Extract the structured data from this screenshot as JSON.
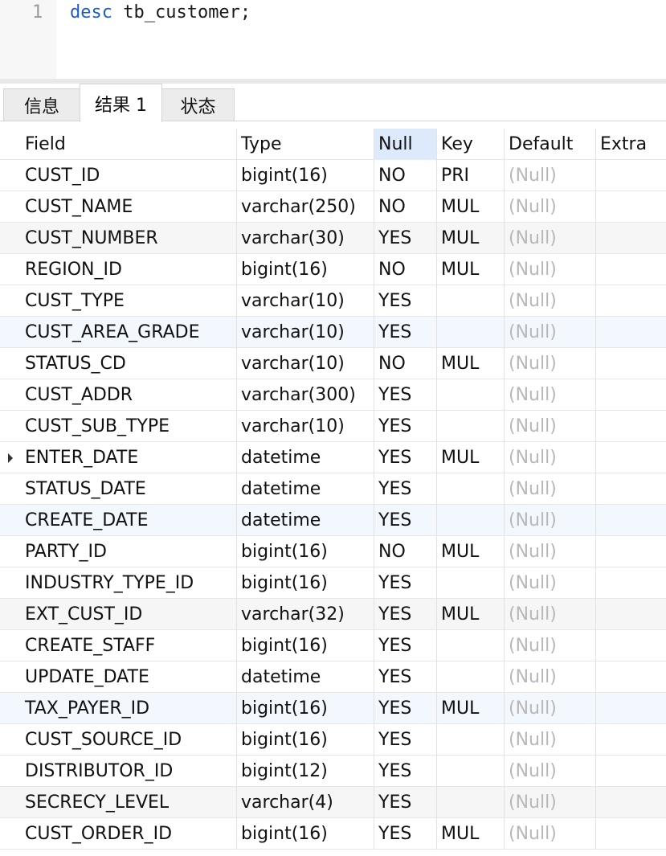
{
  "editor": {
    "line_number": "1",
    "keyword": "desc",
    "rest": " tb_customer;"
  },
  "tabs": [
    {
      "label": "信息",
      "active": false
    },
    {
      "label": "结果 1",
      "active": true
    },
    {
      "label": "状态",
      "active": false
    }
  ],
  "grid": {
    "columns": [
      "Field",
      "Type",
      "Null",
      "Key",
      "Default",
      "Extra"
    ],
    "null_label": "(Null)",
    "current_row_index": 9,
    "rows": [
      [
        "CUST_ID",
        "bigint(16)",
        "NO",
        "PRI",
        "(Null)",
        ""
      ],
      [
        "CUST_NAME",
        "varchar(250)",
        "NO",
        "MUL",
        "(Null)",
        ""
      ],
      [
        "CUST_NUMBER",
        "varchar(30)",
        "YES",
        "MUL",
        "(Null)",
        ""
      ],
      [
        "REGION_ID",
        "bigint(16)",
        "NO",
        "MUL",
        "(Null)",
        ""
      ],
      [
        "CUST_TYPE",
        "varchar(10)",
        "YES",
        "",
        "(Null)",
        ""
      ],
      [
        "CUST_AREA_GRADE",
        "varchar(10)",
        "YES",
        "",
        "(Null)",
        ""
      ],
      [
        "STATUS_CD",
        "varchar(10)",
        "NO",
        "MUL",
        "(Null)",
        ""
      ],
      [
        "CUST_ADDR",
        "varchar(300)",
        "YES",
        "",
        "(Null)",
        ""
      ],
      [
        "CUST_SUB_TYPE",
        "varchar(10)",
        "YES",
        "",
        "(Null)",
        ""
      ],
      [
        "ENTER_DATE",
        "datetime",
        "YES",
        "MUL",
        "(Null)",
        ""
      ],
      [
        "STATUS_DATE",
        "datetime",
        "YES",
        "",
        "(Null)",
        ""
      ],
      [
        "CREATE_DATE",
        "datetime",
        "YES",
        "",
        "(Null)",
        ""
      ],
      [
        "PARTY_ID",
        "bigint(16)",
        "NO",
        "MUL",
        "(Null)",
        ""
      ],
      [
        "INDUSTRY_TYPE_ID",
        "bigint(16)",
        "YES",
        "",
        "(Null)",
        ""
      ],
      [
        "EXT_CUST_ID",
        "varchar(32)",
        "YES",
        "MUL",
        "(Null)",
        ""
      ],
      [
        "CREATE_STAFF",
        "bigint(16)",
        "YES",
        "",
        "(Null)",
        ""
      ],
      [
        "UPDATE_DATE",
        "datetime",
        "YES",
        "",
        "(Null)",
        ""
      ],
      [
        "TAX_PAYER_ID",
        "bigint(16)",
        "YES",
        "MUL",
        "(Null)",
        ""
      ],
      [
        "CUST_SOURCE_ID",
        "bigint(16)",
        "YES",
        "",
        "(Null)",
        ""
      ],
      [
        "DISTRIBUTOR_ID",
        "bigint(12)",
        "YES",
        "",
        "(Null)",
        ""
      ],
      [
        "SECRECY_LEVEL",
        "varchar(4)",
        "YES",
        "",
        "(Null)",
        ""
      ],
      [
        "CUST_ORDER_ID",
        "bigint(16)",
        "YES",
        "MUL",
        "(Null)",
        ""
      ]
    ]
  },
  "colors": {
    "keyword": "#1f5fbf",
    "null_text": "#b8b8b8",
    "selected_header": "#dceafb",
    "row_highlight": "#f2f8fe"
  },
  "icons": {
    "row_indicator": "current-row-arrow-icon"
  }
}
